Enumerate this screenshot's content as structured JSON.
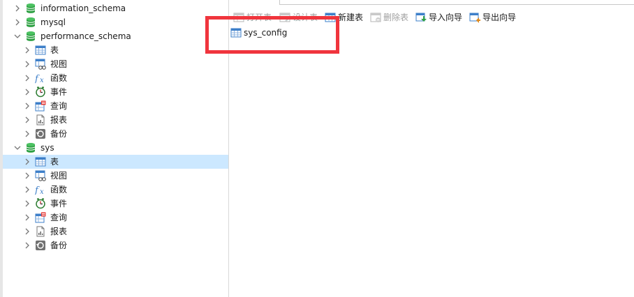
{
  "sidebar": {
    "rows": [
      {
        "label": "information_schema",
        "kind": "db",
        "level": 0,
        "state": "collapsed"
      },
      {
        "label": "mysql",
        "kind": "db",
        "level": 0,
        "state": "collapsed"
      },
      {
        "label": "performance_schema",
        "kind": "db",
        "level": 0,
        "state": "expanded"
      },
      {
        "label": "表",
        "kind": "table",
        "level": 1,
        "state": "collapsed"
      },
      {
        "label": "视图",
        "kind": "view",
        "level": 1,
        "state": "collapsed"
      },
      {
        "label": "函数",
        "kind": "function",
        "level": 1,
        "state": "collapsed"
      },
      {
        "label": "事件",
        "kind": "event",
        "level": 1,
        "state": "collapsed"
      },
      {
        "label": "查询",
        "kind": "query",
        "level": 1,
        "state": "collapsed"
      },
      {
        "label": "报表",
        "kind": "report",
        "level": 1,
        "state": "collapsed"
      },
      {
        "label": "备份",
        "kind": "backup",
        "level": 1,
        "state": "collapsed"
      },
      {
        "label": "sys",
        "kind": "db",
        "level": 0,
        "state": "expanded"
      },
      {
        "label": "表",
        "kind": "table",
        "level": 1,
        "state": "collapsed",
        "selected": true
      },
      {
        "label": "视图",
        "kind": "view",
        "level": 1,
        "state": "collapsed"
      },
      {
        "label": "函数",
        "kind": "function",
        "level": 1,
        "state": "collapsed"
      },
      {
        "label": "事件",
        "kind": "event",
        "level": 1,
        "state": "collapsed"
      },
      {
        "label": "查询",
        "kind": "query",
        "level": 1,
        "state": "collapsed"
      },
      {
        "label": "报表",
        "kind": "report",
        "level": 1,
        "state": "collapsed"
      },
      {
        "label": "备份",
        "kind": "backup",
        "level": 1,
        "state": "collapsed"
      }
    ]
  },
  "toolbar": {
    "open_table": "打开表",
    "design_table": "设计表",
    "new_table": "新建表",
    "delete_table": "删除表",
    "import_wizard": "导入向导",
    "export_wizard": "导出向导"
  },
  "content": {
    "items": [
      {
        "label": "sys_config"
      }
    ]
  },
  "colors": {
    "selection": "#cce8ff",
    "highlight": "#f0353d",
    "db_green": "#2ea043",
    "table_blue": "#3d7fc9"
  },
  "icons": {
    "db": "database-icon",
    "table": "table-icon",
    "view": "view-icon",
    "function": "function-icon",
    "event": "clock-icon",
    "query": "query-icon",
    "report": "report-icon",
    "backup": "backup-icon",
    "collapsed": "chevron-right-icon",
    "expanded": "chevron-down-icon"
  }
}
